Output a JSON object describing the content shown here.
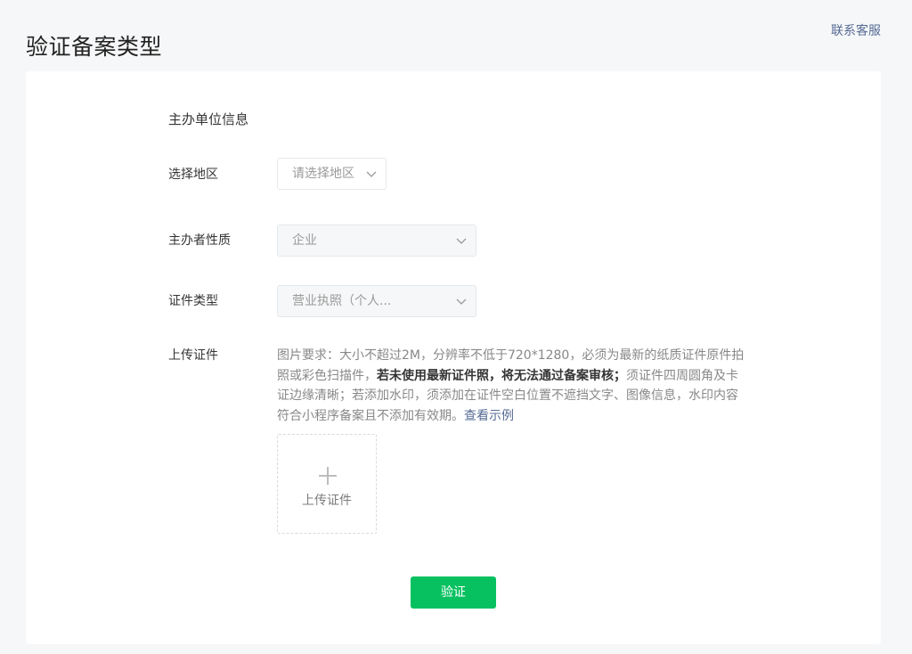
{
  "header": {
    "title": "验证备案类型",
    "contact_label": "联系客服"
  },
  "form": {
    "section_title": "主办单位信息",
    "region": {
      "label": "选择地区",
      "placeholder": "请选择地区"
    },
    "organizer_type": {
      "label": "主办者性质",
      "value": "企业"
    },
    "certificate_type": {
      "label": "证件类型",
      "value": "营业执照（个人..."
    },
    "upload": {
      "label": "上传证件",
      "desc_part1": "图片要求：大小不超过2M，分辨率不低于720*1280，必须为最新的纸质证件原件拍照或彩色扫描件，",
      "desc_bold": "若未使用最新证件照，将无法通过备案审核；",
      "desc_part2": "须证件四周圆角及卡证边缘清晰；若添加水印，须添加在证件空白位置不遮挡文字、图像信息，水印内容符合小程序备案且不添加有效期。",
      "example_link": "查看示例",
      "box_label": "上传证件"
    },
    "submit_label": "验证"
  },
  "icons": {
    "dropdown": "chevron-down-icon",
    "upload": "plus-icon"
  },
  "colors": {
    "accent": "#07c160",
    "link": "#576b95",
    "page_bg": "#f6f7f8"
  }
}
